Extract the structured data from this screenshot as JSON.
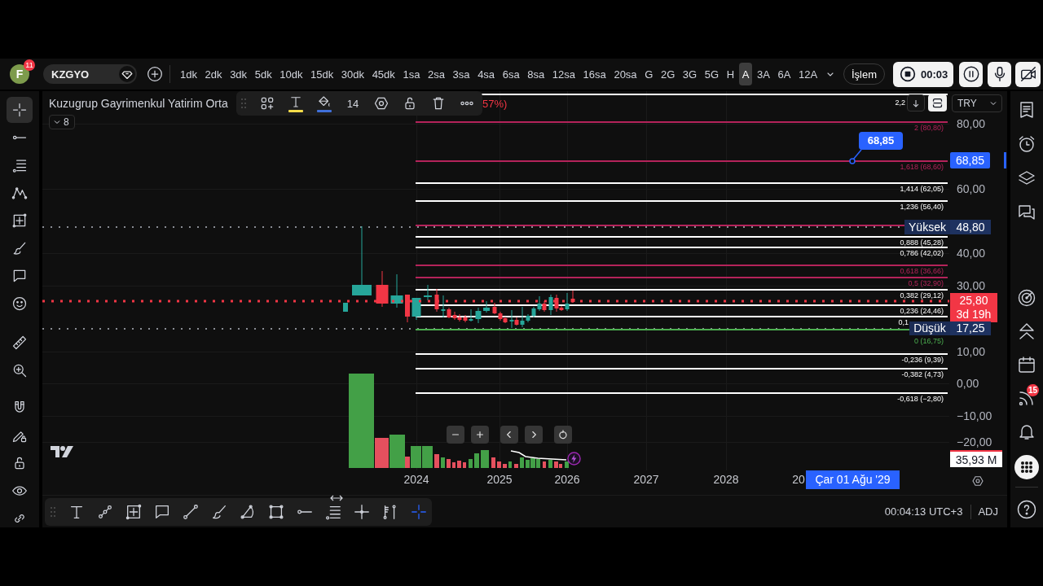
{
  "top_bar": {
    "avatar": {
      "letter": "F",
      "badge": "11"
    },
    "symbol": "KZGYO",
    "intervals": [
      {
        "label": "1dk",
        "selected": false
      },
      {
        "label": "2dk",
        "selected": false
      },
      {
        "label": "3dk",
        "selected": false
      },
      {
        "label": "5dk",
        "selected": false
      },
      {
        "label": "10dk",
        "selected": false
      },
      {
        "label": "15dk",
        "selected": false
      },
      {
        "label": "30dk",
        "selected": false
      },
      {
        "label": "45dk",
        "selected": false
      },
      {
        "label": "1sa",
        "selected": false
      },
      {
        "label": "2sa",
        "selected": false
      },
      {
        "label": "3sa",
        "selected": false
      },
      {
        "label": "4sa",
        "selected": false
      },
      {
        "label": "6sa",
        "selected": false
      },
      {
        "label": "8sa",
        "selected": false
      },
      {
        "label": "12sa",
        "selected": false
      },
      {
        "label": "16sa",
        "selected": false
      },
      {
        "label": "20sa",
        "selected": false
      },
      {
        "label": "G",
        "selected": false
      },
      {
        "label": "2G",
        "selected": false
      },
      {
        "label": "3G",
        "selected": false
      },
      {
        "label": "5G",
        "selected": false
      },
      {
        "label": "H",
        "selected": false
      },
      {
        "label": "A",
        "selected": true
      },
      {
        "label": "3A",
        "selected": false
      },
      {
        "label": "6A",
        "selected": false
      },
      {
        "label": "12A",
        "selected": false
      }
    ],
    "trade_button": "İşlem",
    "recording_time": "00:03"
  },
  "left_toolbar": {
    "groups": [
      {
        "tools": [
          {
            "kind": "crosshair",
            "selected": true
          },
          {
            "kind": "horizontal-line",
            "selected": false
          },
          {
            "kind": "lines",
            "selected": false
          },
          {
            "kind": "pattern",
            "selected": false
          },
          {
            "kind": "grid-box",
            "selected": false
          },
          {
            "kind": "brush",
            "selected": false
          },
          {
            "kind": "callout",
            "selected": false
          },
          {
            "kind": "emoji",
            "selected": false
          }
        ]
      },
      {
        "tools": [
          {
            "kind": "ruler",
            "selected": false
          },
          {
            "kind": "zoom",
            "selected": false
          }
        ]
      },
      {
        "tools": [
          {
            "kind": "magnet",
            "selected": false
          },
          {
            "kind": "draw-lock",
            "selected": false
          },
          {
            "kind": "lock",
            "selected": false
          },
          {
            "kind": "eye",
            "selected": false
          },
          {
            "kind": "link",
            "selected": false
          }
        ]
      }
    ]
  },
  "legend": {
    "title": "Kuzugrup Gayrimenkul Yatirim Orta",
    "change": "57%)",
    "indicator_count": "8"
  },
  "floating_toolbar": {
    "items": [
      {
        "kind": "templates"
      },
      {
        "kind": "text",
        "color": "#f5dc4a"
      },
      {
        "kind": "fill",
        "color": "#3f6fd9"
      },
      {
        "kind": "font-size",
        "label": "14"
      },
      {
        "kind": "settings"
      },
      {
        "kind": "lock"
      },
      {
        "kind": "delete"
      },
      {
        "kind": "more"
      }
    ]
  },
  "chart_controls": {
    "currency": "TRY"
  },
  "fib_levels": [
    {
      "label": "2,2",
      "color": "#ffffff"
    },
    {
      "label": "2 (80,80)",
      "color": "#b4235a"
    },
    {
      "label": "1,618 (68,60)",
      "color": "#b4235a"
    },
    {
      "label": "1,414 (62,05)",
      "color": "#ffffff"
    },
    {
      "label": "1,236 (56,40)",
      "color": "#ffffff"
    },
    {
      "color": "#b4235a"
    },
    {
      "label": "0,888 (45,28)",
      "color": "#ffffff"
    },
    {
      "label": "0,786 (42,02)",
      "color": "#ffffff"
    },
    {
      "label": "0,618 (36,66)",
      "color": "#b4235a"
    },
    {
      "label": "0,5 (32,90)",
      "color": "#b4235a"
    },
    {
      "label": "0,382 (29,12)",
      "color": "#ffffff"
    },
    {
      "label": "0,236 (24,46)",
      "color": "#ffffff"
    },
    {
      "label": "0,1",
      "color": "#ffffff"
    },
    {
      "label": "0 (16,75)",
      "color": "#4caf50"
    },
    {
      "label": "-0,236 (9,39)",
      "color": "#ffffff"
    },
    {
      "label": "-0,382 (4,73)",
      "color": "#ffffff"
    },
    {
      "label": "-0,618 (−2,80)",
      "color": "#ffffff"
    }
  ],
  "price_axis": {
    "labels": [
      "80,00",
      "60,00",
      "40,00",
      "30,00",
      "10,00",
      "0,00",
      "−10,00",
      "−20,00"
    ]
  },
  "price_markers": {
    "cursor_value": "68,85",
    "cursor_callout": "68,85",
    "high": {
      "label": "Yüksek",
      "value": "48,80"
    },
    "current": {
      "value": "25,80",
      "countdown": "3d 19h"
    },
    "low": {
      "label": "Düşük",
      "value": "17,25"
    },
    "volume": "35,93 M"
  },
  "time_axis": {
    "labels": [
      "2024",
      "2025",
      "2026",
      "2027",
      "2028",
      "20"
    ],
    "cursor_date": "Çar 01 Ağu '29"
  },
  "drawing_tools": {
    "tools": [
      {
        "kind": "text",
        "selected": false
      },
      {
        "kind": "nodes-line",
        "selected": false
      },
      {
        "kind": "grid-box",
        "selected": false
      },
      {
        "kind": "callout",
        "selected": false
      },
      {
        "kind": "line",
        "selected": false
      },
      {
        "kind": "brush",
        "selected": false
      },
      {
        "kind": "arc",
        "selected": false
      },
      {
        "kind": "rectangle",
        "selected": false
      },
      {
        "kind": "horizontal-line",
        "selected": false
      },
      {
        "kind": "lines",
        "selected": false
      },
      {
        "kind": "cross",
        "selected": false
      },
      {
        "kind": "tick-lines",
        "selected": false
      },
      {
        "kind": "crosshair",
        "selected": true
      }
    ]
  },
  "status_bar": {
    "time": "00:04:13 UTC+3",
    "adjustment": "ADJ"
  },
  "right_sidebar": {
    "groups": [
      {
        "items": [
          {
            "kind": "watchlist"
          },
          {
            "kind": "alert"
          },
          {
            "kind": "layers"
          },
          {
            "kind": "chat"
          }
        ]
      },
      {
        "items": [
          {
            "kind": "target"
          },
          {
            "kind": "triangles"
          },
          {
            "kind": "calendar"
          },
          {
            "kind": "feed",
            "badge": "15"
          },
          {
            "kind": "bell"
          },
          {
            "kind": "apps"
          }
        ]
      },
      {
        "items": [
          {
            "kind": "help"
          }
        ]
      }
    ]
  }
}
